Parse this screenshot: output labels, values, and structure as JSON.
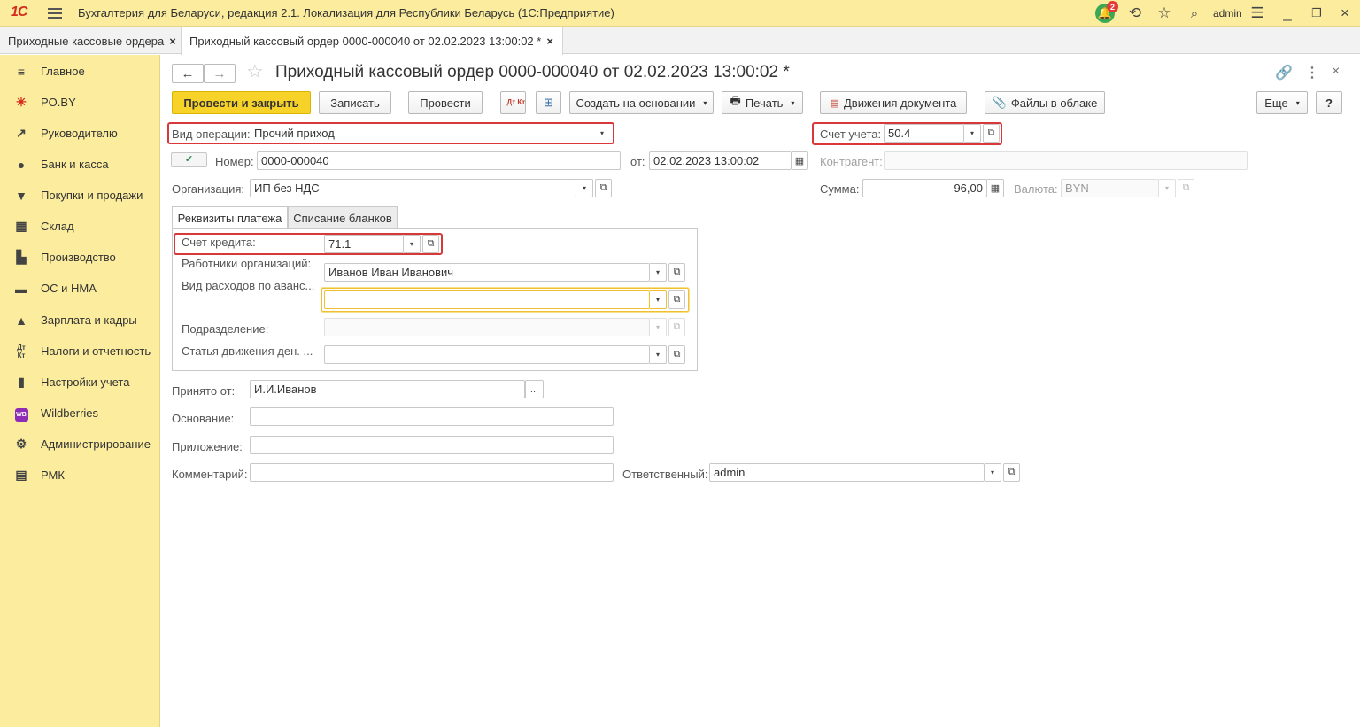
{
  "app": {
    "logo": "1С",
    "title": "Бухгалтерия для Беларуси, редакция 2.1. Локализация для Республики Беларусь  (1С:Предприятие)",
    "notifications_count": "2",
    "user": "admin"
  },
  "tabs": [
    {
      "label": "Приходные кассовые ордера",
      "close": "×"
    },
    {
      "label": "Приходный кассовый ордер 0000-000040 от 02.02.2023 13:00:02 *",
      "close": "×"
    }
  ],
  "sidebar": {
    "items": [
      {
        "label": "Главное",
        "icon": "menu-lines-icon"
      },
      {
        "label": "PO.BY",
        "icon": "sun-icon"
      },
      {
        "label": "Руководителю",
        "icon": "trend-icon"
      },
      {
        "label": "Банк и касса",
        "icon": "coin-icon"
      },
      {
        "label": "Покупки и продажи",
        "icon": "cart-icon"
      },
      {
        "label": "Склад",
        "icon": "warehouse-icon"
      },
      {
        "label": "Производство",
        "icon": "factory-icon"
      },
      {
        "label": "ОС и НМА",
        "icon": "truck-icon"
      },
      {
        "label": "Зарплата и кадры",
        "icon": "person-icon"
      },
      {
        "label": "Налоги и отчетность",
        "icon": "dt-kt-icon"
      },
      {
        "label": "Настройки учета",
        "icon": "book-icon"
      },
      {
        "label": "Wildberries",
        "icon": "wb-icon",
        "badge": "WB"
      },
      {
        "label": "Администрирование",
        "icon": "gear-icon"
      },
      {
        "label": "РМК",
        "icon": "register-icon"
      }
    ]
  },
  "document": {
    "title": "Приходный кассовый ордер 0000-000040 от 02.02.2023 13:00:02 *"
  },
  "toolbar": {
    "post_close": "Провести и закрыть",
    "save": "Записать",
    "post": "Провести",
    "dt_kt": "Дт Кт",
    "create_based": "Создать на основании",
    "print": "Печать",
    "movements": "Движения документа",
    "cloud_files": "Файлы в облаке",
    "more": "Еще",
    "help": "?"
  },
  "form": {
    "operation_label": "Вид операции:",
    "operation_value": "Прочий приход",
    "account_label": "Счет учета:",
    "account_value": "50.4",
    "number_label": "Номер:",
    "number_value": "0000-000040",
    "date_label": "от:",
    "date_value": "02.02.2023 13:00:02",
    "counterparty_label": "Контрагент:",
    "counterparty_value": "",
    "org_label": "Организация:",
    "org_value": "ИП без НДС",
    "sum_label": "Сумма:",
    "sum_value": "96,00",
    "currency_label": "Валюта:",
    "currency_value": "BYN",
    "tab_payment": "Реквизиты платежа",
    "tab_forms": "Списание бланков",
    "credit_account_label": "Счет кредита:",
    "credit_account_value": "71.1",
    "employees_label": "Работники организаций:",
    "employees_value": "Иванов Иван Иванович",
    "expense_type_label": "Вид расходов по аванс...",
    "expense_type_value": "",
    "department_label": "Подразделение:",
    "department_value": "",
    "cash_flow_label": "Статья движения ден. ...",
    "cash_flow_value": "",
    "received_from_label": "Принято от:",
    "received_from_value": "И.И.Иванов",
    "basis_label": "Основание:",
    "basis_value": "",
    "attachment_label": "Приложение:",
    "attachment_value": "",
    "comment_label": "Комментарий:",
    "comment_value": "",
    "responsible_label": "Ответственный:",
    "responsible_value": "admin",
    "ellipsis": "..."
  },
  "colors": {
    "sidebar_bg": "#fbec9e",
    "primary_button": "#f7d32a",
    "highlight_frame": "#d9383a"
  }
}
